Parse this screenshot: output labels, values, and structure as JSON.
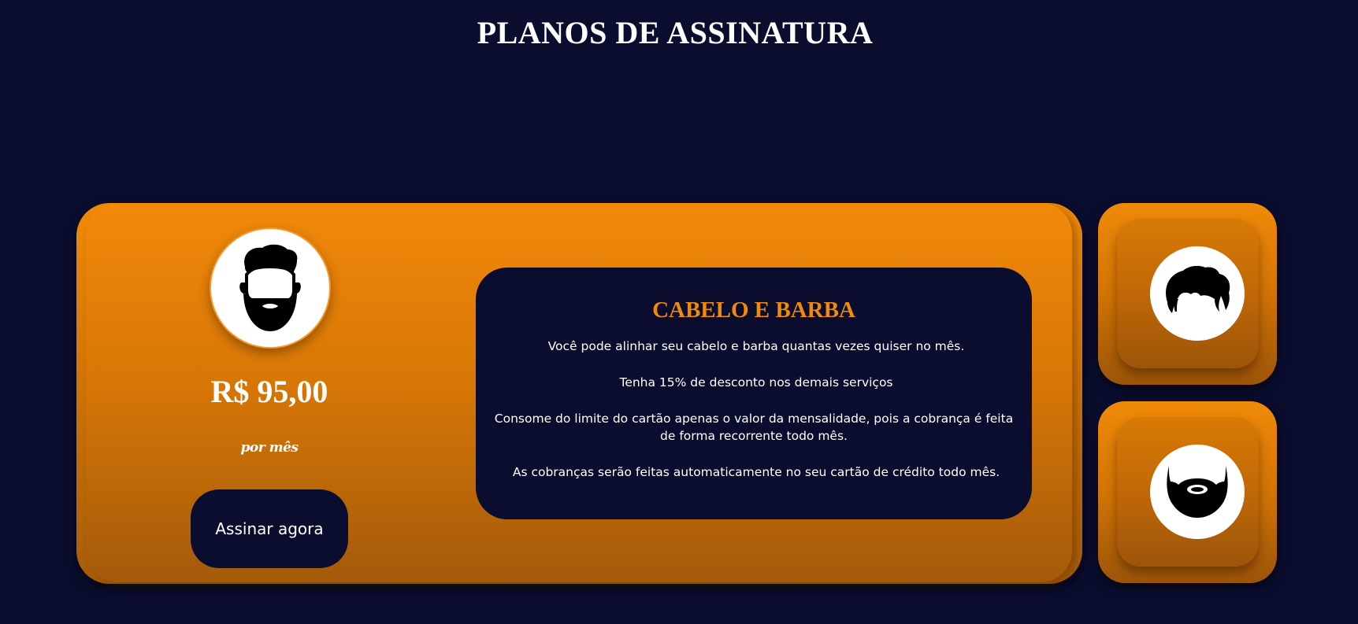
{
  "page": {
    "title": "PLANOS DE ASSINATURA"
  },
  "plan": {
    "price": "R$ 95,00",
    "period": "por mês",
    "button_label": "Assinar agora",
    "icon": "bearded-man-icon",
    "details": {
      "title": "CABELO E BARBA",
      "lines": [
        "Você pode alinhar seu cabelo e barba quantas vezes quiser no mês.",
        "Tenha 15% de desconto nos demais serviços",
        "Consome do limite do cartão apenas o valor da mensalidade, pois a cobrança é feita de forma recorrente todo mês.",
        "As cobranças serão feitas automaticamente no seu cartão de crédito todo mês."
      ]
    }
  },
  "side_plans": [
    {
      "icon": "hair-icon"
    },
    {
      "icon": "beard-icon"
    }
  ],
  "colors": {
    "background": "#0a0d2e",
    "accent": "#f08a08",
    "text": "#ffffff"
  }
}
